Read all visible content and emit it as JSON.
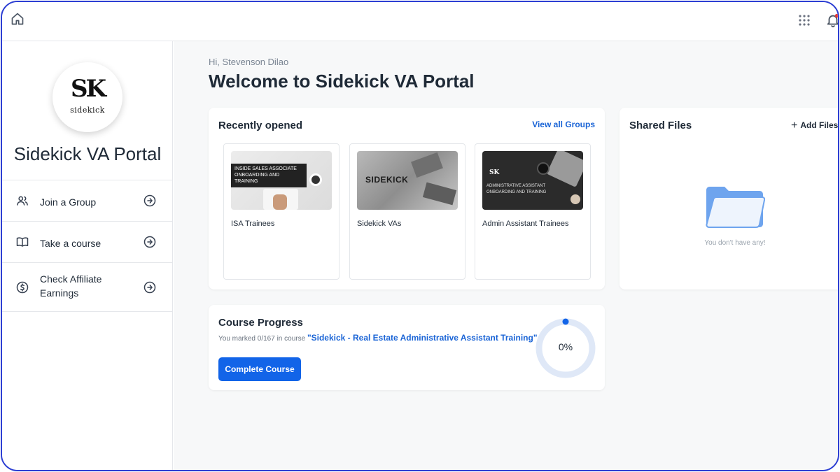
{
  "topbar": {
    "home_icon": "home-icon",
    "apps_icon": "grid-icon",
    "notifications_icon": "bell-icon"
  },
  "sidebar": {
    "logo": {
      "monogram": "SK",
      "wordmark": "sidekick"
    },
    "title": "Sidekick VA Portal",
    "items": [
      {
        "label": "Join a Group",
        "icon": "users-icon"
      },
      {
        "label": "Take a course",
        "icon": "book-icon"
      },
      {
        "label": "Check Affiliate Earnings",
        "icon": "dollar-circle-icon"
      }
    ]
  },
  "main": {
    "greeting": "Hi, Stevenson Dilao",
    "welcome": "Welcome to Sidekick VA Portal",
    "recent": {
      "title": "Recently opened",
      "view_all": "View all Groups",
      "groups": [
        {
          "name": "ISA Trainees",
          "thumb_text": "INSIDE SALES ASSOCIATE ONBOARDING AND TRAINING"
        },
        {
          "name": "Sidekick VAs",
          "thumb_text": "SIDEKICK"
        },
        {
          "name": "Admin Assistant Trainees",
          "thumb_text": "ADMINISTRATIVE ASSISTANT ONBOARDING AND TRAINING"
        }
      ]
    },
    "shared_files": {
      "title": "Shared Files",
      "add_label": "Add Files",
      "empty_text": "You don't have any!"
    },
    "progress": {
      "title": "Course Progress",
      "prefix": "You marked 0/167 in course ",
      "course_name": "\"Sidekick - Real Estate Administrative Assistant Training\"",
      "button_label": "Complete Course",
      "percent_label": "0%",
      "percent_value": 0
    }
  },
  "colors": {
    "accent": "#1264e8",
    "link": "#1a64d6",
    "frame_border": "#2d3fd3",
    "ring_track": "#dfe8f7",
    "folder": "#6ea4ee"
  }
}
